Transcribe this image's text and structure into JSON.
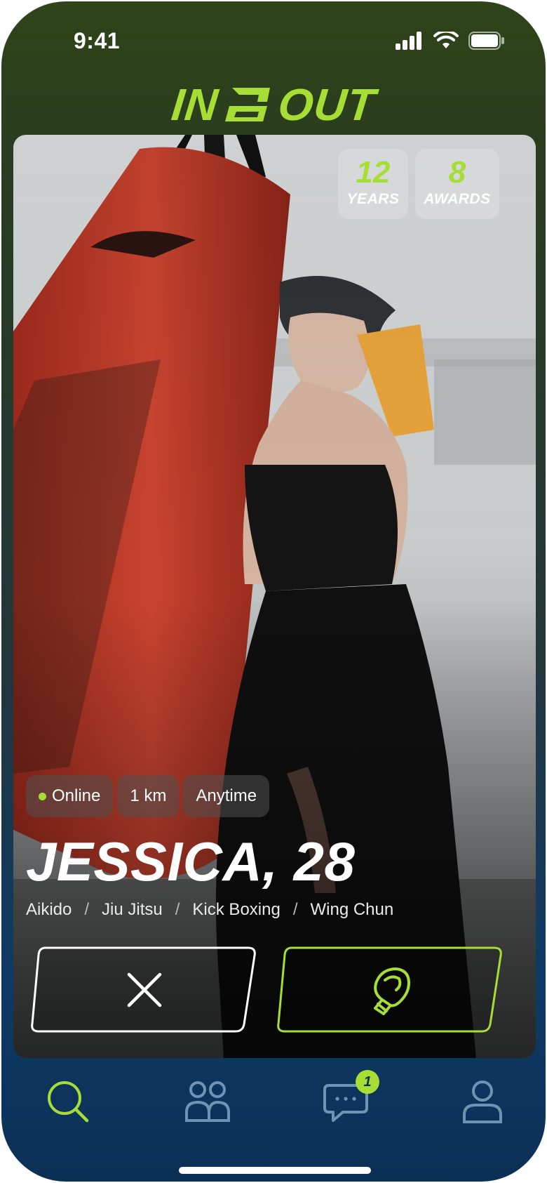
{
  "status_bar": {
    "time": "9:41"
  },
  "logo": {
    "left": "IN",
    "right": "OUT"
  },
  "stats": [
    {
      "value": "12",
      "label": "YEARS"
    },
    {
      "value": "8",
      "label": "AWARDS"
    }
  ],
  "chips": {
    "status": "Online",
    "distance": "1 km",
    "availability": "Anytime"
  },
  "profile": {
    "name": "JESSICA, 28"
  },
  "martial_arts": [
    "Aikido",
    "Jiu Jitsu",
    "Kick Boxing",
    "Wing Chun"
  ],
  "separator": "/",
  "nav": {
    "messages_badge": "1"
  },
  "colors": {
    "accent": "#a6de35",
    "nav_bg": "#0b3056"
  },
  "icons": {
    "reject": "close-icon",
    "like": "boxing-glove-icon",
    "search": "search-icon",
    "community": "people-icon",
    "messages": "chat-icon",
    "profile": "user-icon"
  }
}
